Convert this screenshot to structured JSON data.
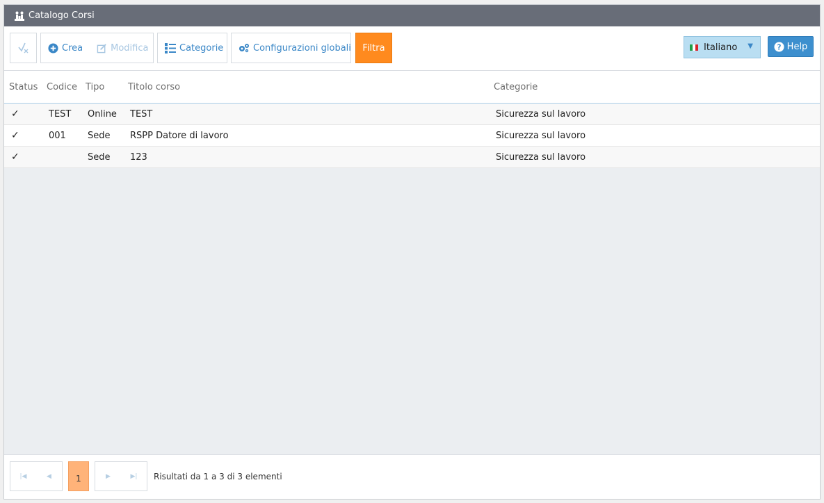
{
  "window": {
    "title": "Catalogo Corsi"
  },
  "toolbar": {
    "crea_label": "Crea",
    "modifica_label": "Modifica",
    "categorie_label": "Categorie",
    "config_label": "Configurazioni globali",
    "filtra_label": "Filtra",
    "language": "Italiano",
    "help_label": "Help"
  },
  "table": {
    "headers": [
      "Status",
      "Codice",
      "Tipo",
      "Titolo corso",
      "Categorie"
    ],
    "rows": [
      {
        "status": "✓",
        "codice": "TEST",
        "tipo": "Online",
        "titolo": "TEST",
        "categorie": "Sicurezza sul lavoro"
      },
      {
        "status": "✓",
        "codice": "001",
        "tipo": "Sede",
        "titolo": "RSPP Datore di lavoro",
        "categorie": "Sicurezza sul lavoro"
      },
      {
        "status": "✓",
        "codice": "",
        "tipo": "Sede",
        "titolo": "123",
        "categorie": "Sicurezza sul lavoro"
      }
    ]
  },
  "pager": {
    "current_page": "1",
    "info": "Risultati da 1 a 3 di 3 elementi"
  },
  "colors": {
    "titlebar": "#686d78",
    "accent": "#3a87c7",
    "filtra": "#ff8a1e",
    "language_bg": "#b9def2",
    "help": "#3d8fce",
    "page_active": "#ffb379"
  }
}
